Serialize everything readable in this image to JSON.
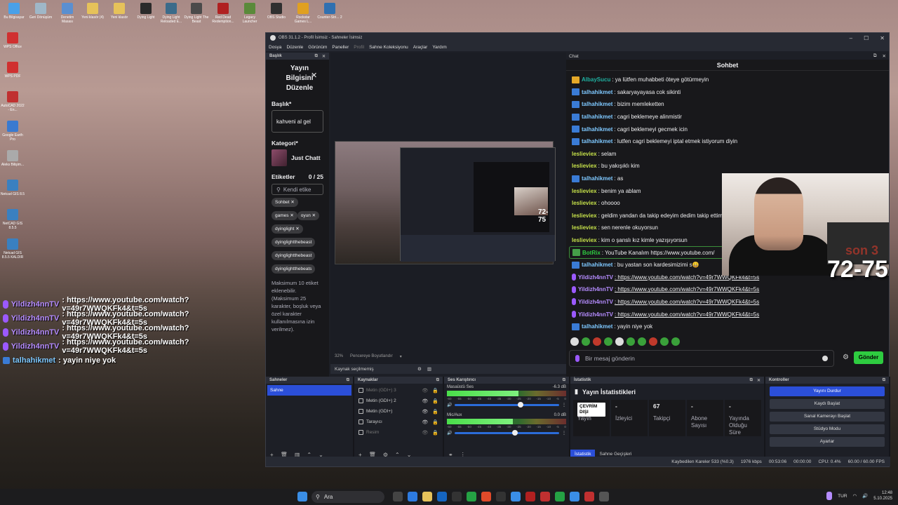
{
  "desktop": {
    "top_icons": [
      {
        "label": "Bu Bilgisayar",
        "color": "#4aa0e8"
      },
      {
        "label": "Geri Dönüşüm",
        "color": "#9fb7c8"
      },
      {
        "label": "Denetim Masası",
        "color": "#5a8fd0"
      },
      {
        "label": "Yeni klasör (4)",
        "color": "#e6c25a"
      },
      {
        "label": "Yeni klasör",
        "color": "#e6c25a"
      },
      {
        "label": "Dying Light",
        "color": "#2b2b2b"
      },
      {
        "label": "Dying Light Reloaded E...",
        "color": "#3b6b8a"
      },
      {
        "label": "Dying Light The Beast",
        "color": "#4a4a4a"
      },
      {
        "label": "Red Dead Redemption...",
        "color": "#b02020"
      },
      {
        "label": "Legacy Launcher",
        "color": "#5a8a3a"
      },
      {
        "label": "OBS Studio",
        "color": "#303030"
      },
      {
        "label": "Rockstar Games L...",
        "color": "#e0a020"
      },
      {
        "label": "Counter-Stri... 2",
        "color": "#3070b0"
      }
    ],
    "left_icons": [
      {
        "label": "WPS Office",
        "color": "#d03030"
      },
      {
        "label": "WPS PDF",
        "color": "#d03030"
      },
      {
        "label": "AutoCAD 2022 - En...",
        "color": "#c03030"
      },
      {
        "label": "Google Earth Pro",
        "color": "#3a7ad0"
      },
      {
        "label": "Aleks Bilişim...",
        "color": "#aaaaaa"
      },
      {
        "label": "Netcad GIS 8.5",
        "color": "#3a80c0"
      },
      {
        "label": "NetCAD GIS 8.5.5",
        "color": "#3a80c0"
      },
      {
        "label": "Netcad GIS 8.5.5 KALDIR",
        "color": "#3a80c0"
      }
    ]
  },
  "overlay_chat": [
    {
      "user": "Yildizh4nnTV",
      "text": ": https://www.youtube.com/watch?v=49r7WWQKFk4&t=5s",
      "kind": "purple"
    },
    {
      "user": "Yildizh4nnTV",
      "text": ": https://www.youtube.com/watch?v=49r7WWQKFk4&t=5s",
      "kind": "purple"
    },
    {
      "user": "Yildizh4nnTV",
      "text": ": https://www.youtube.com/watch?v=49r7WWQKFk4&t=5s",
      "kind": "purple"
    },
    {
      "user": "Yildizh4nnTV",
      "text": ": https://www.youtube.com/watch?v=49r7WWQKFk4&t=5s",
      "kind": "purple"
    },
    {
      "user": "talhahikmet",
      "text": ": yayin niye yok",
      "kind": "blue"
    }
  ],
  "obs": {
    "title": "OBS 31.1.2 - Profil İsimsiz - Sahneler İsimsiz",
    "menu": [
      "Dosya",
      "Düzenle",
      "Görünüm",
      "Paneller",
      "Profil",
      "Sahne Koleksiyonu",
      "Araçlar",
      "Yardım"
    ],
    "info_dock": {
      "header": "Başlık",
      "title": "Yayın Bilgisini Düzenle",
      "title_label": "Başlık*",
      "title_value": "kahveni al gel",
      "category_label": "Kategori*",
      "category_value": "Just Chatt",
      "tags_label": "Etiketler",
      "tags_count": "0 / 25",
      "tags_search": "Kendi etike",
      "tags": [
        "Sohbet ✕",
        "games ✕",
        "oyun ✕",
        "dyinglight ✕",
        "dyinglightthebeast",
        "dyinglightthebeast",
        "dyinglightthebeats"
      ],
      "note": "Maksimum 10 etiket eklenebilir. (Maksimum 25 karakter, boşluk veya özel karakter kullanılmasına izin verilmez)."
    },
    "preview": {
      "score": "72-75",
      "zoom": "32%",
      "fit": "Pencereye Boyutlandır",
      "source_sel": "Kaynak seçilmemiş"
    },
    "chat": {
      "header": "Chat",
      "title": "Sohbet",
      "messages": [
        {
          "user": "AlbaySucu",
          "text": ": ya lütfen muhabbeti öteye götürmeyin",
          "color": "#1fb0a0",
          "icon": "gold"
        },
        {
          "user": "talhahikmet",
          "text": ": sakaryayayasa cok sikinti",
          "color": "#7ec8ff",
          "icon": "blue"
        },
        {
          "user": "talhahikmet",
          "text": ": bizim memleketten",
          "color": "#7ec8ff",
          "icon": "blue"
        },
        {
          "user": "talhahikmet",
          "text": ": cagri beklemeye alinmistir",
          "color": "#7ec8ff",
          "icon": "blue"
        },
        {
          "user": "talhahikmet",
          "text": ": cagri beklemeyi gecmek icin",
          "color": "#7ec8ff",
          "icon": "blue"
        },
        {
          "user": "talhahikmet",
          "text": ": lutfen cagri beklemeyi iptal etmek istiyorum diyin",
          "color": "#7ec8ff",
          "icon": "blue"
        },
        {
          "user": "leslieviex",
          "text": ": selam",
          "color": "#c5e04a",
          "icon": "none"
        },
        {
          "user": "leslieviex",
          "text": ": bu yakışıklı kim",
          "color": "#c5e04a",
          "icon": "none"
        },
        {
          "user": "talhahikmet",
          "text": ": as",
          "color": "#7ec8ff",
          "icon": "blue"
        },
        {
          "user": "leslieviex",
          "text": ": benim ya ablam",
          "color": "#c5e04a",
          "icon": "none"
        },
        {
          "user": "leslieviex",
          "text": ": ohoooo",
          "color": "#c5e04a",
          "icon": "none"
        },
        {
          "user": "leslieviex",
          "text": ": geldim yandan da takip edeyim dedim takip ettim",
          "color": "#c5e04a",
          "icon": "none"
        },
        {
          "user": "leslieviex",
          "text": ": sen nerenle okuyorsun",
          "color": "#c5e04a",
          "icon": "none"
        },
        {
          "user": "leslieviex",
          "text": ": kim o şanslı kız kimle yazışıyorsun",
          "color": "#c5e04a",
          "icon": "none"
        },
        {
          "user": "BotRix",
          "text": ": YouTube Kanalım https://www.youtube.com/",
          "color": "#2ecc40",
          "icon": "bot",
          "highlight": true
        },
        {
          "user": "talhahikmet",
          "text": ": bu yastan son kardesimizimi s😄",
          "color": "#7ec8ff",
          "icon": "blue"
        },
        {
          "user": "Yildizh4nnTV",
          "text": ": https://www.youtube.com/watch?v=49r7WWQKFk4&t=5s",
          "color": "#b58cff",
          "icon": "mic",
          "link": true
        },
        {
          "user": "Yildizh4nnTV",
          "text": ": https://www.youtube.com/watch?v=49r7WWQKFk4&t=5s",
          "color": "#b58cff",
          "icon": "mic",
          "link": true
        },
        {
          "user": "Yildizh4nnTV",
          "text": ": https://www.youtube.com/watch?v=49r7WWQKFk4&t=5s",
          "color": "#b58cff",
          "icon": "mic",
          "link": true
        },
        {
          "user": "Yildizh4nnTV",
          "text": ": https://www.youtube.com/watch?v=49r7WWQKFk4&t=5s",
          "color": "#b58cff",
          "icon": "mic",
          "link": true
        },
        {
          "user": "talhahikmet",
          "text": ": yayin niye yok",
          "color": "#7ec8ff",
          "icon": "blue"
        }
      ],
      "cam_score": "72-75",
      "cam_score_faded": "son 3",
      "input_placeholder": "Bir mesaj gönderin",
      "send_label": "Gönder"
    },
    "scenes": {
      "header": "Sahneler",
      "items": [
        "Sahne"
      ]
    },
    "sources": {
      "header": "Kaynaklar",
      "items": [
        {
          "label": "Metin (GDI+) 3",
          "dim": true
        },
        {
          "label": "Metin (GDI+) 2",
          "dim": false
        },
        {
          "label": "Metin (GDI+)",
          "dim": false
        },
        {
          "label": "Tarayıcı",
          "dim": false
        },
        {
          "label": "Resim",
          "dim": true
        }
      ]
    },
    "mixer": {
      "header": "Ses Karıştırıcı",
      "channels": [
        {
          "name": "Masaüstü Ses",
          "db": "-6.3 dB",
          "level": 0.6
        },
        {
          "name": "Mic/Aux",
          "db": "0.0 dB",
          "level": 0.55
        }
      ],
      "ticks": [
        "-60",
        "-55",
        "-50",
        "-45",
        "-40",
        "-35",
        "-30",
        "-25",
        "-20",
        "-15",
        "-10",
        "-5",
        "0"
      ]
    },
    "stats": {
      "header": "İstatistik",
      "title": "Yayın İstatistikleri",
      "cards": [
        {
          "value": "ÇEVRİM DIŞI",
          "label": "Yayın",
          "offline": true
        },
        {
          "value": "-",
          "label": "İzleyici"
        },
        {
          "value": "67",
          "label": "Takipçi"
        },
        {
          "value": "-",
          "label": "Abone Sayısı"
        },
        {
          "value": "-",
          "label": "Yayında Olduğu Süre"
        }
      ],
      "tabs": [
        "İstatistik",
        "Sahne Geçişleri"
      ]
    },
    "controls": {
      "header": "Kontroller",
      "buttons": [
        "Yayını Durdur",
        "Kaydı Başlat",
        "Sanal Kamerayı Başlat",
        "Stüdyo Modu",
        "Ayarlar"
      ]
    },
    "status": {
      "dropped": "Kaybedilen Kareler 533 (%0.3)",
      "bitrate": "1976 kbps",
      "stream_time": "00:53:06",
      "rec_time": "00:00:00",
      "cpu": "CPU: 0.4%",
      "fps": "60.00 / 60.00 FPS"
    }
  },
  "taskbar": {
    "search": "Ara",
    "lang": "TUR",
    "time": "12:48",
    "date": "5.10.2025"
  }
}
